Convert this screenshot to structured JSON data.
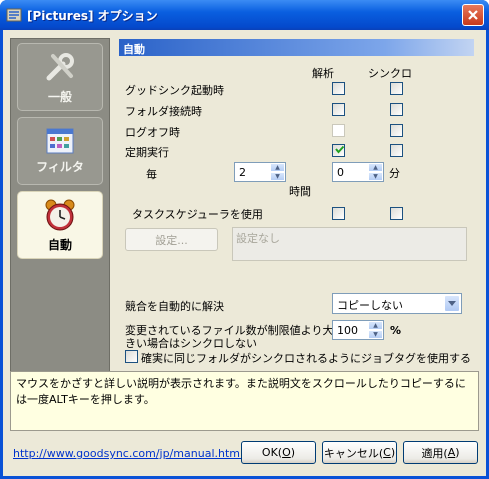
{
  "window": {
    "title": "[Pictures] オプション",
    "close_label": "✕"
  },
  "sidebar": {
    "items": [
      {
        "label": "一般",
        "icon": "tools-icon",
        "active": false
      },
      {
        "label": "フィルタ",
        "icon": "filter-grid-icon",
        "active": false
      },
      {
        "label": "自動",
        "icon": "alarm-clock-icon",
        "active": true
      }
    ]
  },
  "section": {
    "title": "自動",
    "col_analyze": "解析",
    "col_sync": "シンクロ"
  },
  "rows": {
    "gsync_start": {
      "label": "グッドシンク起動時",
      "analyze": false,
      "sync": false
    },
    "folder_connect": {
      "label": "フォルダ接続時",
      "analyze": false,
      "sync": false
    },
    "logoff": {
      "label": "ログオフ時",
      "analyze": false,
      "sync": false,
      "analyze_disabled": true
    },
    "periodic": {
      "label": "定期実行",
      "analyze": true,
      "sync": false
    },
    "every_label": "毎",
    "hours_value": "2",
    "minutes_value": "0",
    "minutes_unit": "分",
    "hours_unit": "時間",
    "scheduler": {
      "label": "タスクスケジューラを使用",
      "analyze": false,
      "sync": false
    },
    "settings_button": "設定...",
    "settings_text": "設定なし"
  },
  "conflict": {
    "label": "競合を自動的に解決",
    "selected": "コピーしない"
  },
  "limit": {
    "label_line1": "変更されているファイル数が制限値より大",
    "label_line2": "きい場合はシンクロしない",
    "value": "100",
    "unit": "%"
  },
  "jobtag": {
    "label": "確実に同じフォルダがシンクロされるようにジョブタグを使用する",
    "checked": false
  },
  "info": {
    "text": "マウスをかざすと詳しい説明が表示されます。また説明文をスクロールしたりコピーするには一度ALTキーを押します。"
  },
  "footer": {
    "help_link": "http://www.goodsync.com/jp/manual.html",
    "ok_prefix": "OK(",
    "ok_key": "O",
    "ok_suffix": ")",
    "cancel_prefix": "キャンセル(",
    "cancel_key": "C",
    "cancel_suffix": ")",
    "apply_prefix": "適用(",
    "apply_key": "A",
    "apply_suffix": ")"
  }
}
